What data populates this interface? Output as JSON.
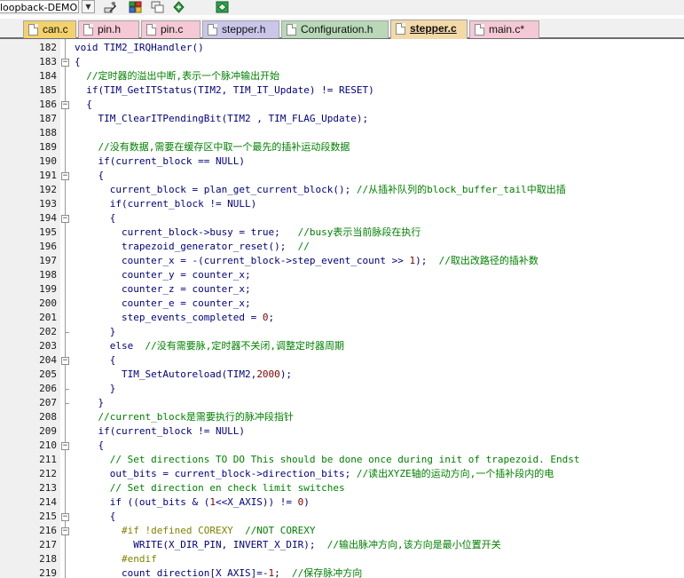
{
  "toolbar": {
    "project": "loopback-DEMO",
    "icons": [
      "target-options-icon",
      "manage-components-icon",
      "multi-project-icon",
      "select-device-icon",
      "pack-installer-icon"
    ]
  },
  "tabs": [
    {
      "label": "can.c",
      "color": "#f3d16b",
      "active": false
    },
    {
      "label": "pin.h",
      "color": "#f4c8d4",
      "active": false
    },
    {
      "label": "pin.c",
      "color": "#f4c8d4",
      "active": false
    },
    {
      "label": "stepper.h",
      "color": "#c9c6ea",
      "active": false
    },
    {
      "label": "Configuration.h",
      "color": "#b8d8b8",
      "active": false
    },
    {
      "label": "stepper.c",
      "color": "#f3d9a8",
      "active": true
    },
    {
      "label": "main.c*",
      "color": "#f4c8d4",
      "active": false
    }
  ],
  "colors": {
    "code": "#000080",
    "comment": "#008000",
    "number": "#800000",
    "preprocessor": "#808000"
  },
  "lines": [
    {
      "n": "182",
      "fold": "",
      "segs": [
        {
          "t": "void TIM2_IRQHandler()",
          "c": "kw"
        }
      ]
    },
    {
      "n": "183",
      "fold": "-",
      "segs": [
        {
          "t": "{",
          "c": "kw"
        }
      ]
    },
    {
      "n": "184",
      "fold": "",
      "segs": [
        {
          "t": "  //定时器的溢出中断,表示一个脉冲输出开始",
          "c": "cm"
        }
      ]
    },
    {
      "n": "185",
      "fold": "",
      "segs": [
        {
          "t": "  if(TIM_GetITStatus(TIM2, TIM_IT_Update) != RESET)",
          "c": "kw"
        }
      ]
    },
    {
      "n": "186",
      "fold": "-",
      "segs": [
        {
          "t": "  {",
          "c": "kw"
        }
      ]
    },
    {
      "n": "187",
      "fold": "",
      "segs": [
        {
          "t": "    TIM_ClearITPendingBit(TIM2 , TIM_FLAG_Update);",
          "c": "kw"
        }
      ]
    },
    {
      "n": "188",
      "fold": "",
      "segs": []
    },
    {
      "n": "189",
      "fold": "",
      "segs": [
        {
          "t": "    //没有数据,需要在缓存区中取一个最先的插补运动段数据",
          "c": "cm"
        }
      ]
    },
    {
      "n": "190",
      "fold": "",
      "segs": [
        {
          "t": "    if(current_block == NULL)",
          "c": "kw"
        }
      ]
    },
    {
      "n": "191",
      "fold": "-",
      "segs": [
        {
          "t": "    {",
          "c": "kw"
        }
      ]
    },
    {
      "n": "192",
      "fold": "",
      "segs": [
        {
          "t": "      current_block = plan_get_current_block(); ",
          "c": "kw"
        },
        {
          "t": "//从插补队列的block_buffer_tail中取出插",
          "c": "cm"
        }
      ]
    },
    {
      "n": "193",
      "fold": "",
      "segs": [
        {
          "t": "      if(current_block != NULL)",
          "c": "kw"
        }
      ]
    },
    {
      "n": "194",
      "fold": "-",
      "segs": [
        {
          "t": "      {",
          "c": "kw"
        }
      ]
    },
    {
      "n": "195",
      "fold": "",
      "segs": [
        {
          "t": "        current_block->busy = true;   ",
          "c": "kw"
        },
        {
          "t": "//busy表示当前脉段在执行",
          "c": "cm"
        }
      ]
    },
    {
      "n": "196",
      "fold": "",
      "segs": [
        {
          "t": "        trapezoid_generator_reset();  ",
          "c": "kw"
        },
        {
          "t": "//",
          "c": "cm"
        }
      ]
    },
    {
      "n": "197",
      "fold": "",
      "segs": [
        {
          "t": "        counter_x = -(current_block->step_event_count >> ",
          "c": "kw"
        },
        {
          "t": "1",
          "c": "num"
        },
        {
          "t": ");  ",
          "c": "kw"
        },
        {
          "t": "//取出改路径的插补数",
          "c": "cm"
        }
      ]
    },
    {
      "n": "198",
      "fold": "",
      "segs": [
        {
          "t": "        counter_y = counter_x;",
          "c": "kw"
        }
      ]
    },
    {
      "n": "199",
      "fold": "",
      "segs": [
        {
          "t": "        counter_z = counter_x;",
          "c": "kw"
        }
      ]
    },
    {
      "n": "200",
      "fold": "",
      "segs": [
        {
          "t": "        counter_e = counter_x;",
          "c": "kw"
        }
      ]
    },
    {
      "n": "201",
      "fold": "",
      "segs": [
        {
          "t": "        step_events_completed = ",
          "c": "kw"
        },
        {
          "t": "0",
          "c": "num"
        },
        {
          "t": ";",
          "c": "kw"
        }
      ]
    },
    {
      "n": "202",
      "fold": "|",
      "segs": [
        {
          "t": "      }",
          "c": "kw"
        }
      ]
    },
    {
      "n": "203",
      "fold": "",
      "segs": [
        {
          "t": "      else  ",
          "c": "kw"
        },
        {
          "t": "//没有需要脉,定时器不关闭,调整定时器周期",
          "c": "cm"
        }
      ]
    },
    {
      "n": "204",
      "fold": "-",
      "segs": [
        {
          "t": "      {",
          "c": "kw"
        }
      ]
    },
    {
      "n": "205",
      "fold": "",
      "segs": [
        {
          "t": "        TIM_SetAutoreload(TIM2,",
          "c": "kw"
        },
        {
          "t": "2000",
          "c": "num"
        },
        {
          "t": ");",
          "c": "kw"
        }
      ]
    },
    {
      "n": "206",
      "fold": "|",
      "segs": [
        {
          "t": "      }",
          "c": "kw"
        }
      ]
    },
    {
      "n": "207",
      "fold": "|",
      "segs": [
        {
          "t": "    }",
          "c": "kw"
        }
      ]
    },
    {
      "n": "208",
      "fold": "",
      "segs": [
        {
          "t": "    //current_block是需要执行的脉冲段指针",
          "c": "cm"
        }
      ]
    },
    {
      "n": "209",
      "fold": "",
      "segs": [
        {
          "t": "    if(current_block != NULL)",
          "c": "kw"
        }
      ]
    },
    {
      "n": "210",
      "fold": "-",
      "segs": [
        {
          "t": "    {",
          "c": "kw"
        }
      ]
    },
    {
      "n": "211",
      "fold": "",
      "segs": [
        {
          "t": "      // Set directions TO DO This should be done once during init of trapezoid. Endst",
          "c": "cm"
        }
      ]
    },
    {
      "n": "212",
      "fold": "",
      "segs": [
        {
          "t": "      out_bits = current_block->direction_bits; ",
          "c": "kw"
        },
        {
          "t": "//读出XYZE轴的运动方向,一个插补段内的电",
          "c": "cm"
        }
      ]
    },
    {
      "n": "213",
      "fold": "",
      "segs": [
        {
          "t": "      // Set direction en check limit switches",
          "c": "cm"
        }
      ]
    },
    {
      "n": "214",
      "fold": "",
      "segs": [
        {
          "t": "      if ((out_bits & (",
          "c": "kw"
        },
        {
          "t": "1",
          "c": "num"
        },
        {
          "t": "<<X_AXIS)) != ",
          "c": "kw"
        },
        {
          "t": "0",
          "c": "num"
        },
        {
          "t": ")",
          "c": "kw"
        }
      ]
    },
    {
      "n": "215",
      "fold": "-",
      "segs": [
        {
          "t": "      {",
          "c": "kw"
        }
      ]
    },
    {
      "n": "216",
      "fold": "-",
      "segs": [
        {
          "t": "        #if !defined COREXY  ",
          "c": "pp"
        },
        {
          "t": "//NOT COREXY",
          "c": "cm"
        }
      ]
    },
    {
      "n": "217",
      "fold": "",
      "segs": [
        {
          "t": "          WRITE(X_DIR_PIN, INVERT_X_DIR);  ",
          "c": "kw"
        },
        {
          "t": "//输出脉冲方向,该方向是最小位置开关",
          "c": "cm"
        }
      ]
    },
    {
      "n": "218",
      "fold": "",
      "segs": [
        {
          "t": "        #endif",
          "c": "pp"
        }
      ]
    },
    {
      "n": "219",
      "fold": "",
      "segs": [
        {
          "t": "        count_direction[X_AXIS]=-",
          "c": "kw"
        },
        {
          "t": "1",
          "c": "num"
        },
        {
          "t": ";  ",
          "c": "kw"
        },
        {
          "t": "//保存脉冲方向",
          "c": "cm"
        }
      ]
    }
  ]
}
